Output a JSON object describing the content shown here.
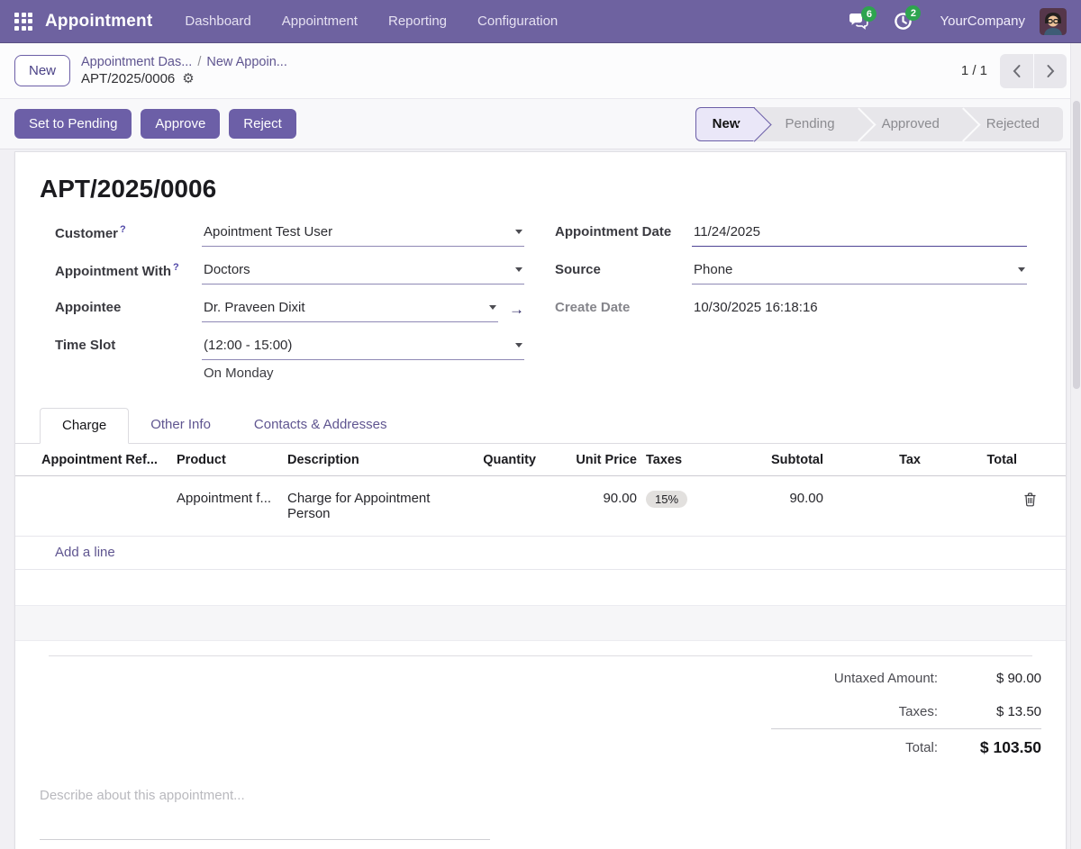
{
  "colors": {
    "navbar_bg": "#6e62a0",
    "accent_purple": "#6c5fa7",
    "badge_green": "#2ea44f",
    "link_purple": "#5f5590"
  },
  "icons": {
    "gear": "⚙",
    "internal_link": "→"
  },
  "navbar": {
    "app_name": "Appointment",
    "menu_items": [
      "Dashboard",
      "Appointment",
      "Reporting",
      "Configuration"
    ],
    "messages_badge": "6",
    "activities_badge": "2",
    "company": "YourCompany"
  },
  "breadcrumb": {
    "new_button": "New",
    "link_1": "Appointment Das...",
    "separator": "/",
    "link_2": "New Appoin...",
    "current": "APT/2025/0006",
    "pager": "1 / 1"
  },
  "statusbar": {
    "buttons": [
      "Set to Pending",
      "Approve",
      "Reject"
    ],
    "steps": [
      {
        "label": "New",
        "active": true
      },
      {
        "label": "Pending",
        "active": false
      },
      {
        "label": "Approved",
        "active": false
      },
      {
        "label": "Rejected",
        "active": false
      }
    ]
  },
  "form": {
    "title": "APT/2025/0006",
    "customer": {
      "label": "Customer",
      "help": "?",
      "value": "Apointment Test User"
    },
    "appointment_with": {
      "label": "Appointment With",
      "help": "?",
      "value": "Doctors"
    },
    "appointee": {
      "label": "Appointee",
      "value": "Dr. Praveen Dixit"
    },
    "time_slot": {
      "label": "Time Slot",
      "value": "(12:00 - 15:00)",
      "note": "On Monday"
    },
    "appointment_date": {
      "label": "Appointment Date",
      "value": "11/24/2025"
    },
    "source": {
      "label": "Source",
      "value": "Phone"
    },
    "create_date": {
      "label": "Create Date",
      "value": "10/30/2025 16:18:16"
    },
    "tabs": [
      "Charge",
      "Other Info",
      "Contacts & Addresses"
    ],
    "table": {
      "headers": [
        "Appointment Ref...",
        "Product",
        "Description",
        "Quantity",
        "Unit Price",
        "Taxes",
        "Subtotal",
        "Tax",
        "Total"
      ],
      "row": {
        "product": "Appointment f...",
        "description": "Charge for Appointment Person",
        "unit_price": "90.00",
        "taxes_badge": "15%",
        "subtotal": "90.00"
      },
      "add_line": "Add a line"
    },
    "totals": {
      "untaxed_label": "Untaxed Amount:",
      "untaxed_value": "$ 90.00",
      "taxes_label": "Taxes:",
      "taxes_value": "$ 13.50",
      "total_label": "Total:",
      "total_value": "$ 103.50"
    },
    "description_placeholder": "Describe about this appointment..."
  }
}
